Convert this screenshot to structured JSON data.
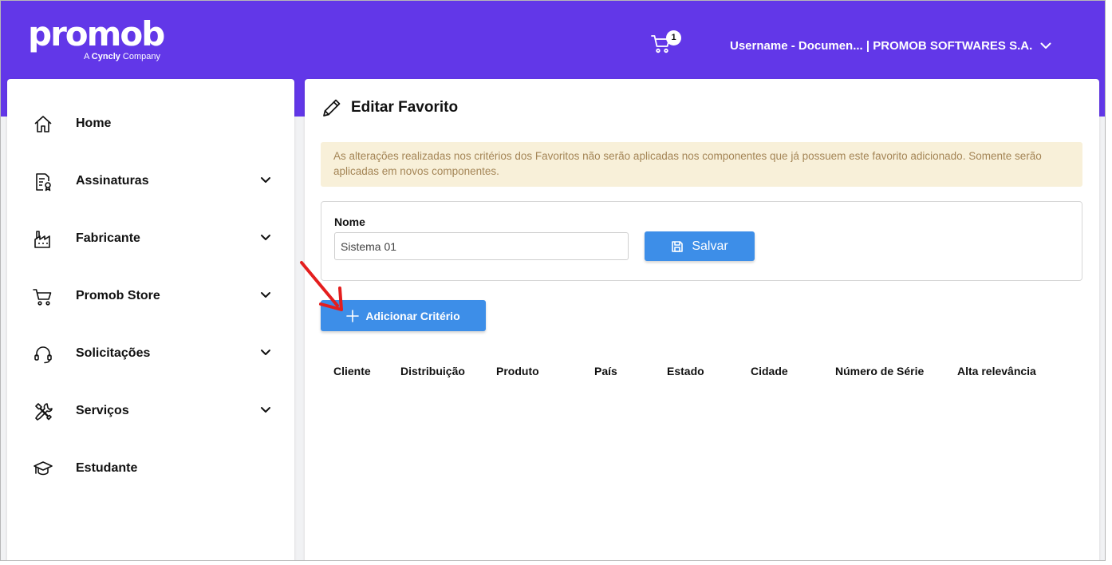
{
  "header": {
    "logo": {
      "text": "promob",
      "sub_prefix": "A ",
      "sub_brand": "Cyncly",
      "sub_suffix": " Company"
    },
    "cart": {
      "icon": "cart-icon",
      "count": "1"
    },
    "user_label": "Username - Documen... | PROMOB SOFTWARES S.A.",
    "user_chevron_icon": "chevron-down-icon",
    "color": "#6237e8"
  },
  "sidebar": {
    "items": [
      {
        "label": "Home",
        "icon": "home-icon",
        "expandable": false
      },
      {
        "label": "Assinaturas",
        "icon": "certificate-document-icon",
        "expandable": true
      },
      {
        "label": "Fabricante",
        "icon": "factory-icon",
        "expandable": true
      },
      {
        "label": "Promob Store",
        "icon": "cart-icon",
        "expandable": true
      },
      {
        "label": "Solicitações",
        "icon": "headset-icon",
        "expandable": true
      },
      {
        "label": "Serviços",
        "icon": "tools-icon",
        "expandable": true
      },
      {
        "label": "Estudante",
        "icon": "graduation-cap-icon",
        "expandable": false
      }
    ]
  },
  "main": {
    "title": "Editar Favorito",
    "title_icon": "pencil-icon",
    "alert": "As alterações realizadas nos critérios dos Favoritos não serão aplicadas nos componentes que já possuem este favorito adicionado. Somente serão aplicadas em novos componentes.",
    "form": {
      "name_label": "Nome",
      "name_value": "Sistema 01",
      "save_label": "Salvar",
      "save_icon": "save-icon"
    },
    "add_criterion_label": "Adicionar Critério",
    "add_icon": "plus-icon",
    "table": {
      "columns": [
        "Cliente",
        "Distribuição",
        "Produto",
        "País",
        "Estado",
        "Cidade",
        "Número de Série",
        "Alta relevância"
      ]
    },
    "primary_color": "#3d8ee8",
    "alert_bg": "#f8f0d9",
    "annotation_arrow_color": "#e41e1e"
  }
}
